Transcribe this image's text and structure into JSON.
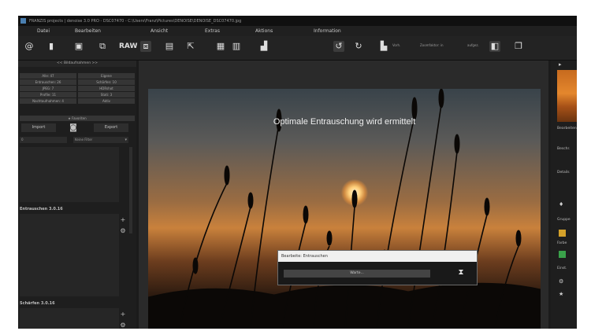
{
  "window": {
    "title": "FRANZIS projects | denoise 3.0 PRO - DSC07470 - C:\\Users\\Franz\\Pictures\\DENOISE\\DENOISE_DSC07470.jpg"
  },
  "menu": [
    "Datei",
    "Bearbeiten",
    "Ansicht",
    "Extras",
    "Aktions",
    "Information"
  ],
  "toolbar": {
    "raw_label": "RAW",
    "left_label": "Vorh.",
    "mid_label": "Zoomfaktor: in",
    "right_label": "aufgez."
  },
  "left_panel": {
    "header": "<< Bildaufnahmen >>",
    "filters": [
      [
        "Alle: 47",
        "Eigene"
      ],
      [
        "Entrauschen: 26",
        "Schärfen: 10"
      ],
      [
        "JPEG: 7",
        "HDRshot"
      ],
      [
        "Profile: 11",
        "Stati: 3"
      ],
      [
        "Nachtaufnahmen: 4",
        "Aktiv"
      ]
    ],
    "favorites": "Favoriten",
    "import_label": "Import",
    "export_label": "Export",
    "select_input": "0",
    "select_dropdown": "Keine Filter",
    "pane1_title": "Entrauschen 3.0.16",
    "pane2_title": "Schärfen 3.0.16"
  },
  "center": {
    "photo_caption": "Optimale Entrauschung wird ermittelt"
  },
  "dialog": {
    "title": "Bearbeite: Entrauschen",
    "progress_label": "Warte...",
    "progress": 0.0
  },
  "right_panel": {
    "labels": [
      "Bearbeiten",
      "Beschr.",
      "Details",
      "Gruppe",
      "Farbe",
      "Einst."
    ]
  },
  "icons": {
    "toolbar": [
      "help-icon",
      "file-icon",
      "image-icon",
      "copy-icon",
      "raw-icon",
      "crop-icon",
      "save-icon",
      "export-icon",
      "print-icon",
      "compare-icon",
      "histogram-icon",
      "rotate-left-icon",
      "rotate-right-icon",
      "split-icon",
      "before-after-icon",
      "copy-frame-icon"
    ]
  },
  "colors": {
    "app_bg": "#1b1b1b",
    "dialog_title_bg": "#f0f0f0",
    "sunset_orange": "#c9813c"
  }
}
